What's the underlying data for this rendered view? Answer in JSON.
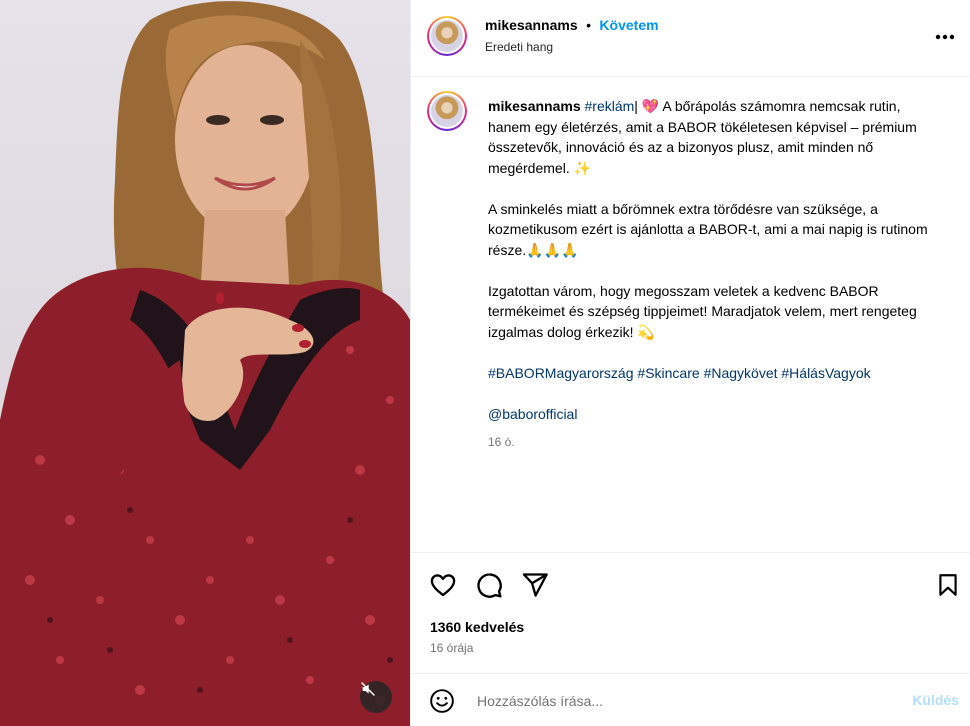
{
  "post": {
    "author": "mikesannams",
    "follow_label": "Követem",
    "audio": "Eredeti hang",
    "caption_author": "mikesannams",
    "caption_first_tag": "#reklám",
    "caption_p1": "| 💖 A bőrápolás számomra nemcsak rutin, hanem egy életérzés, amit a BABOR tökéletesen képvisel – prémium összetevők, innováció és az a bizonyos plusz, amit minden nő megérdemel. ✨",
    "caption_p2": "A sminkelés miatt a bőrömnek extra törődésre van szüksége, a kozmetikusom ezért is ajánlotta a BABOR-t, ami a mai napig is rutinom része.🙏🙏🙏",
    "caption_p3": "Izgatottan várom, hogy megosszam veletek a kedvenc BABOR termékeimet és szépség tippjeimet! Maradjatok velem, mert rengeteg izgalmas dolog érkezik! 💫",
    "hashtags": [
      "#BABORMagyarország",
      "#Skincare",
      "#Nagykövet",
      "#HálásVagyok"
    ],
    "mention": "@baborofficial",
    "caption_time": "16 ó.",
    "likes": "1360 kedvelés",
    "time_ago": "16 órája"
  },
  "comment": {
    "placeholder": "Hozzászólás írása...",
    "send_label": "Küldés"
  },
  "icons": {
    "more": "more-horizontal-icon",
    "like": "heart-icon",
    "comment": "comment-bubble-icon",
    "share": "paper-plane-icon",
    "save": "bookmark-icon",
    "emoji": "emoji-smile-icon",
    "mute": "speaker-muted-icon"
  },
  "colors": {
    "link": "#0095f6",
    "hashtag": "#00376b",
    "muted": "#737373",
    "send_disabled": "#b2dffc"
  }
}
